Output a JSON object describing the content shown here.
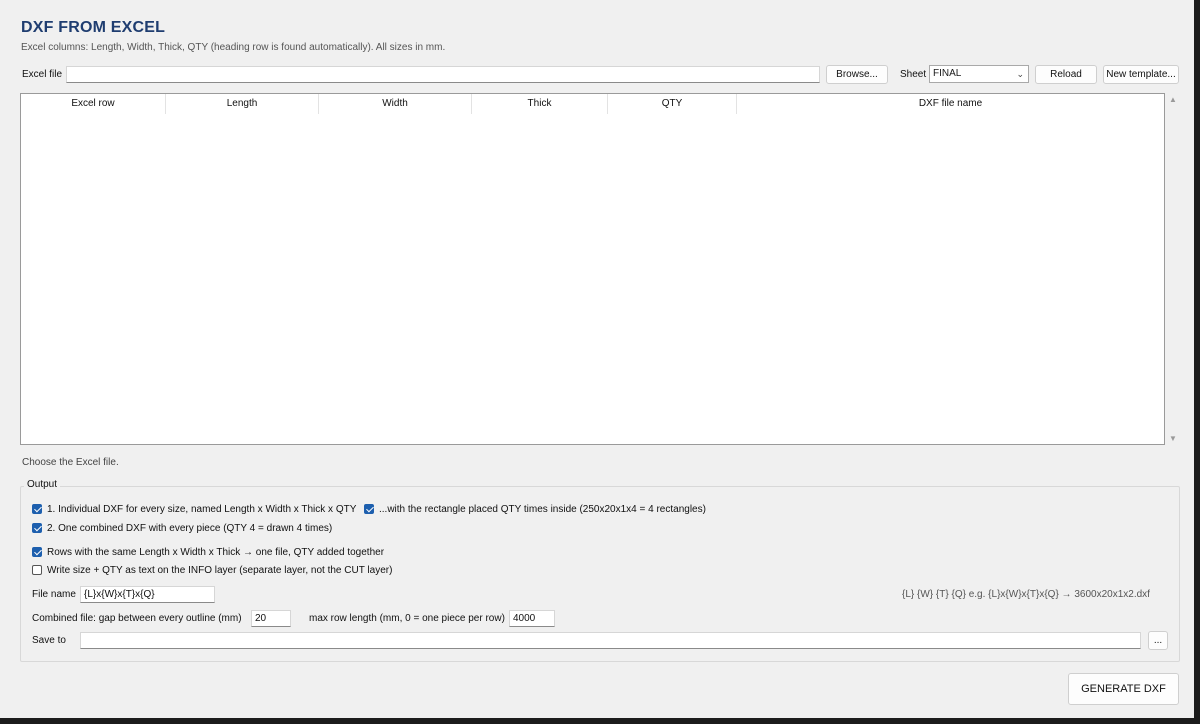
{
  "header": {
    "title": "DXF FROM EXCEL",
    "subtitle": "Excel columns: Length, Width, Thick, QTY (heading row is found automatically). All sizes in mm."
  },
  "file_row": {
    "excel_file_label": "Excel file",
    "excel_file_value": "",
    "browse_label": "Browse...",
    "sheet_label": "Sheet",
    "sheet_value": "FINAL",
    "reload_label": "Reload",
    "new_template_label": "New template..."
  },
  "table": {
    "columns": [
      "Excel row",
      "Length",
      "Width",
      "Thick",
      "QTY",
      "DXF file name"
    ],
    "rows": []
  },
  "status": "Choose the Excel file.",
  "output": {
    "group_title": "Output",
    "options": {
      "individual": {
        "label": "1.  Individual DXF for every size, named Length x Width x Thick x QTY",
        "checked": true
      },
      "placed_qty": {
        "label": "...with the rectangle placed QTY times inside (250x20x1x4 = 4 rectangles)",
        "checked": true
      },
      "combined": {
        "label": "2.  One combined DXF with every piece (QTY 4 = drawn 4 times)",
        "checked": true
      },
      "merge_rows": {
        "label": "Rows with the same Length x Width x Thick → one file, QTY added together",
        "checked": true
      },
      "write_info": {
        "label": "Write size + QTY as text on the INFO layer (separate layer, not the CUT layer)",
        "checked": false
      }
    },
    "file_name_label": "File name",
    "file_name_value": "{L}x{W}x{T}x{Q}",
    "file_name_hint": "{L} {W} {T} {Q}  e.g.  {L}x{W}x{T}x{Q}  →  3600x20x1x2.dxf",
    "combined_label": "Combined file:  gap between every outline (mm)",
    "gap_value": "20",
    "max_row_label": "max row length (mm, 0 = one piece per row)",
    "max_row_value": "4000",
    "save_to_label": "Save to",
    "save_to_value": "",
    "save_browse_label": "..."
  },
  "generate_label": "GENERATE DXF",
  "icons": {
    "dropdown": "chevron-down-icon",
    "scroll_up": "triangle-up-icon",
    "scroll_down": "triangle-down-icon"
  }
}
